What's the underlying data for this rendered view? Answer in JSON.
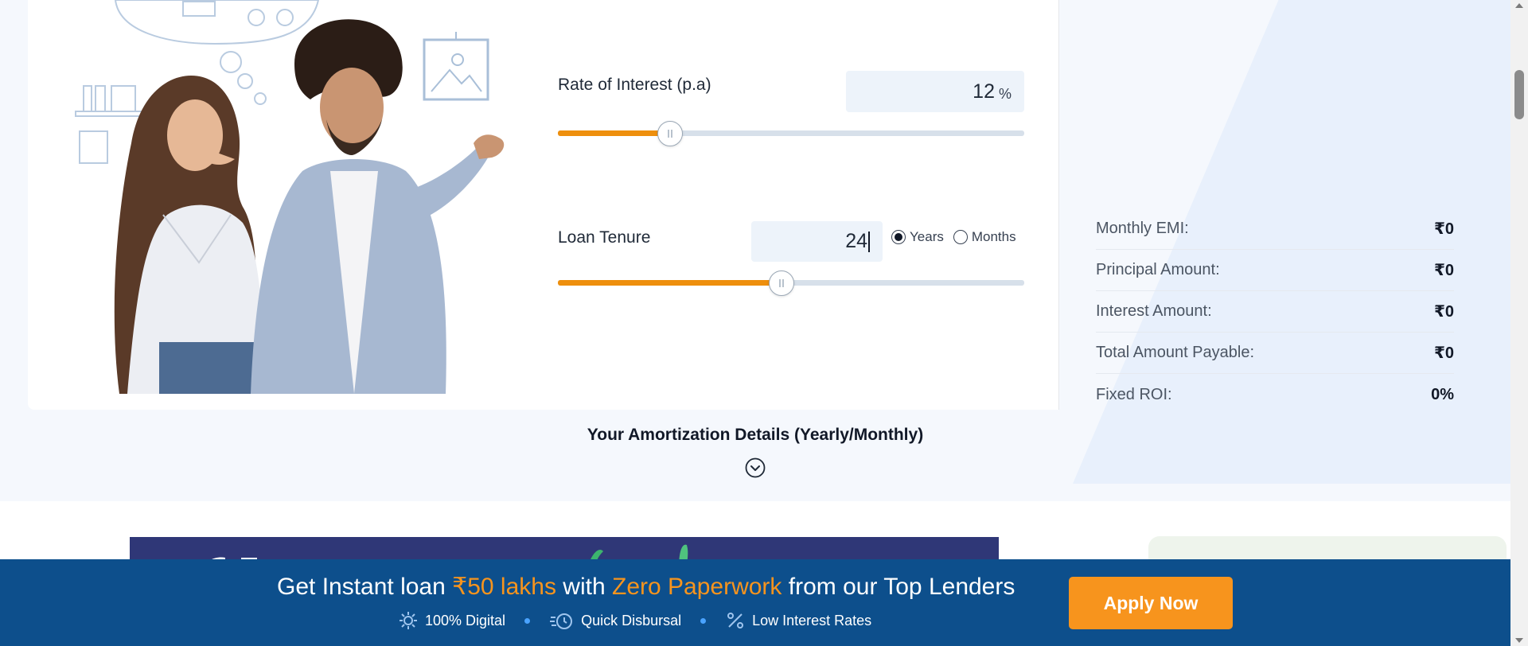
{
  "calculator": {
    "rate": {
      "label": "Rate of Interest (p.a)",
      "value": "12",
      "unit": "%",
      "slider_fraction": 0.24
    },
    "tenure": {
      "label": "Loan Tenure",
      "value": "24",
      "slider_fraction": 0.48,
      "options": [
        {
          "label": "Years",
          "selected": true
        },
        {
          "label": "Months",
          "selected": false
        }
      ]
    }
  },
  "summary": {
    "rows": [
      {
        "label": "Monthly EMI:",
        "value": "₹0"
      },
      {
        "label": "Principal Amount:",
        "value": "₹0"
      },
      {
        "label": "Interest Amount:",
        "value": "₹0"
      },
      {
        "label": "Total Amount Payable:",
        "value": "₹0"
      },
      {
        "label": "Fixed ROI:",
        "value": "0%"
      }
    ]
  },
  "amortization": {
    "title": "Your Amortization Details (Yearly/Monthly)",
    "toggle_icon": "chevron-down-circle-icon"
  },
  "sticky_bar": {
    "headline_part1": "Get Instant loan ",
    "headline_highlight1": "₹50 lakhs",
    "headline_part2": " with ",
    "headline_highlight2": "Zero Paperwork",
    "headline_part3": " from our Top Lenders",
    "features": [
      {
        "icon": "digital-icon",
        "label": "100% Digital"
      },
      {
        "icon": "quick-disbursal-icon",
        "label": "Quick Disbursal"
      },
      {
        "icon": "percent-icon",
        "label": "Low Interest Rates"
      }
    ],
    "cta": "Apply Now"
  },
  "colors": {
    "accent": "#f7941d",
    "slider_fill": "#ee8f0d",
    "bar_bg": "#0d4f8c",
    "input_bg": "#edf3fa"
  }
}
